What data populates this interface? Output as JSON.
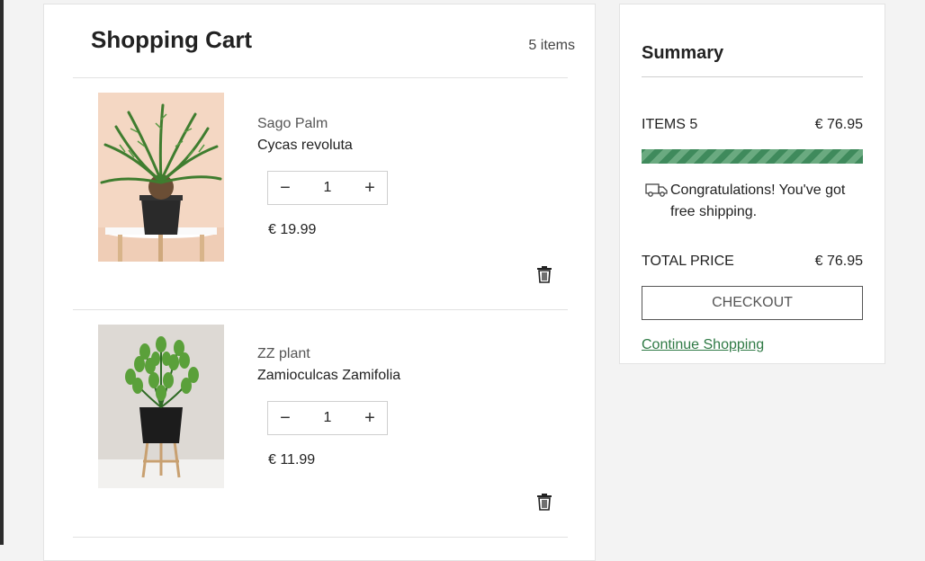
{
  "cart": {
    "title": "Shopping Cart",
    "item_count_label": "5 items",
    "items": [
      {
        "name": "Sago Palm",
        "latin": "Cycas revoluta",
        "quantity": "1",
        "price": "€ 19.99",
        "decrease": "−",
        "increase": "+"
      },
      {
        "name": "ZZ plant",
        "latin": "Zamioculcas Zamifolia",
        "quantity": "1",
        "price": "€ 11.99",
        "decrease": "−",
        "increase": "+"
      }
    ]
  },
  "summary": {
    "title": "Summary",
    "items_label": "ITEMS 5",
    "items_total": "€ 76.95",
    "shipping_progress": 1.0,
    "shipping_message": "Congratulations! You've got free shipping.",
    "total_label": "TOTAL PRICE",
    "total_value": "€ 76.95",
    "checkout_label": "CHECKOUT",
    "continue_label": "Continue Shopping"
  },
  "icons": {
    "decrease": "minus-icon",
    "increase": "plus-icon",
    "remove": "trash-icon",
    "shipping": "truck-icon"
  },
  "colors": {
    "accent_green": "#2f7a45",
    "progress_stripe": "#3f8a5c",
    "background": "#f3f3f3"
  }
}
